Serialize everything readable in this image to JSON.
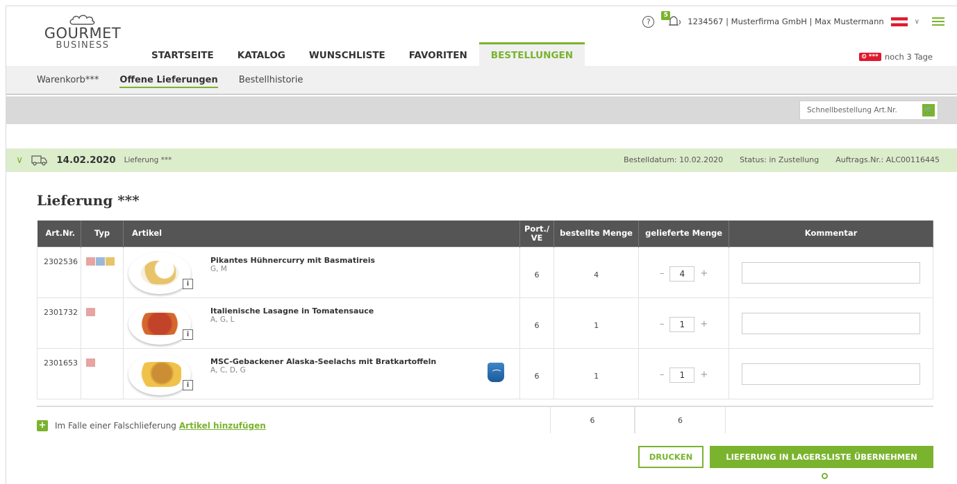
{
  "header": {
    "brand": "GOURMET",
    "brand_sub": "BUSINESS",
    "notification_count": "5",
    "account": "1234567 | Musterfirma GmbH | Max Mustermann",
    "help_icon": "?",
    "deadline_tag": "***",
    "deadline_text": "noch 3 Tage",
    "accent": "#7ab32e",
    "alert_red": "#e0192d"
  },
  "nav": {
    "items": [
      {
        "label": "STARTSEITE"
      },
      {
        "label": "KATALOG"
      },
      {
        "label": "WUNSCHLISTE"
      },
      {
        "label": "FAVORITEN"
      },
      {
        "label": "BESTELLUNGEN"
      }
    ],
    "active": "BESTELLUNGEN"
  },
  "subnav": {
    "items": [
      {
        "label": "Warenkorb***"
      },
      {
        "label": "Offene Lieferungen"
      },
      {
        "label": "Bestellhistorie"
      }
    ],
    "active": "Offene Lieferungen"
  },
  "quickorder": {
    "placeholder": "Schnellbestellung Art.Nr."
  },
  "delivery": {
    "date": "14.02.2020",
    "label": "Lieferung ***",
    "order_date": "Bestelldatum: 10.02.2020",
    "status": "Status: in Zustellung",
    "order_nr": "Auftrags.Nr.: ALC00116445"
  },
  "page_title": "Lieferung ***",
  "table": {
    "headers": {
      "artnr": "Art.Nr.",
      "typ": "Typ",
      "artikel": "Artikel",
      "port": "Port./ VE",
      "bestellt": "bestellte Menge",
      "geliefert": "gelieferte Menge",
      "kommentar": "Kommentar"
    },
    "rows": [
      {
        "artnr": "2302536",
        "name": "Pikantes Hühnercurry mit Basmatireis",
        "allergens": "G, M",
        "port": "6",
        "ordered": "4",
        "delivered": "4"
      },
      {
        "artnr": "2301732",
        "name": "Italienische Lasagne in Tomatensauce",
        "allergens": "A, G, L",
        "port": "6",
        "ordered": "1",
        "delivered": "1"
      },
      {
        "artnr": "2301653",
        "name": "MSC-Gebackener Alaska-Seelachs mit Bratkartoffeln",
        "allergens": "A, C, D, G",
        "port": "6",
        "ordered": "1",
        "delivered": "1"
      }
    ],
    "total_ordered": "6",
    "total_delivered": "6",
    "info_label": "i",
    "minus": "–",
    "plus": "+"
  },
  "add_article": {
    "text": "Im Falle einer Falschlieferung",
    "link": "Artikel hinzufügen",
    "icon": "+"
  },
  "buttons": {
    "print": "DRUCKEN",
    "save": "LIEFERUNG IN LAGERSLISTE ÜBERNEHMEN"
  }
}
